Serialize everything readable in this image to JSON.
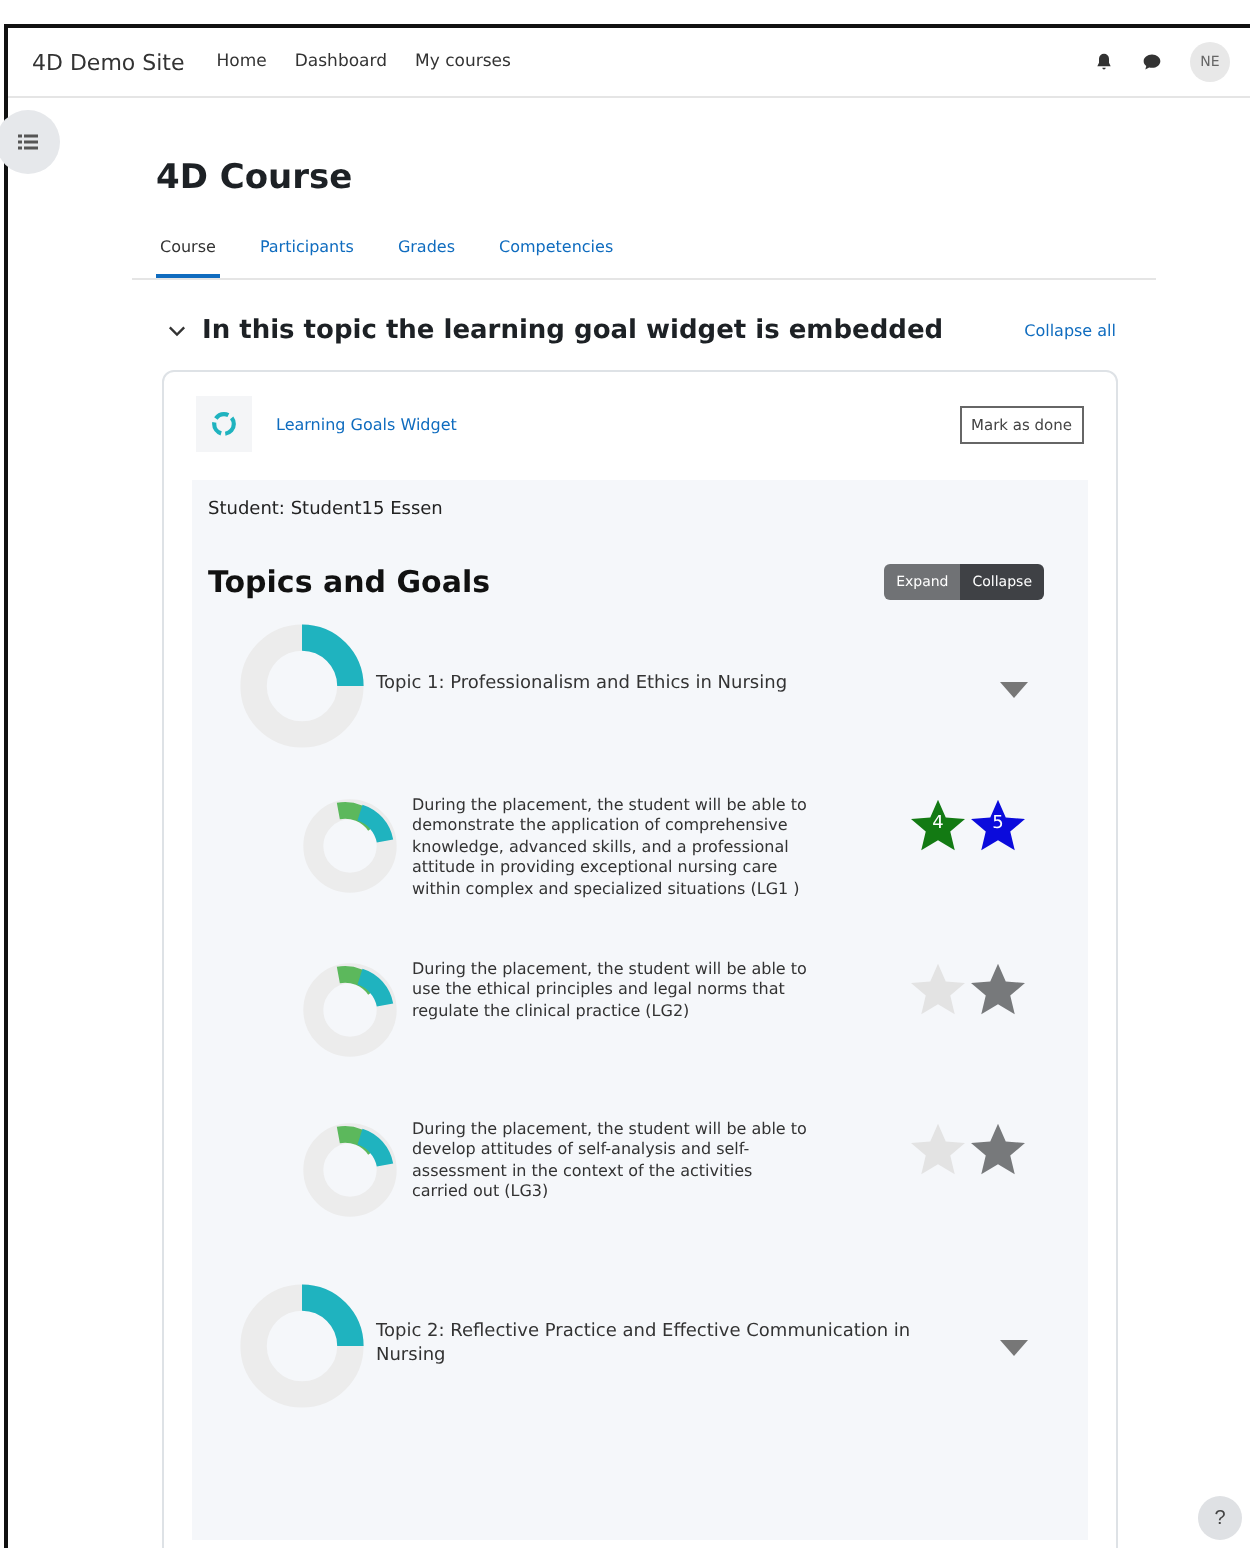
{
  "navbar": {
    "site_name": "4D Demo Site",
    "links": [
      "Home",
      "Dashboard",
      "My courses"
    ],
    "avatar": "NE"
  },
  "course": {
    "title": "4D Course",
    "tabs": [
      {
        "label": "Course",
        "selected": true
      },
      {
        "label": "Participants",
        "selected": false
      },
      {
        "label": "Grades",
        "selected": false
      },
      {
        "label": "Competencies",
        "selected": false
      }
    ]
  },
  "section": {
    "title": "In this topic the learning goal widget is embedded",
    "expanded": true,
    "collapse_all": "Collapse all"
  },
  "activity": {
    "name": "Learning Goals Widget",
    "mark_button": "Mark as done"
  },
  "widget": {
    "student": "Student: Student15 Essen",
    "heading": "Topics and Goals",
    "toggle": [
      {
        "label": "Expand",
        "selected": false
      },
      {
        "label": "Collapse",
        "selected": true
      }
    ],
    "items": [
      {
        "kind": "topic",
        "text": "Topic 1: Professionalism and Ethics in Nursing"
      },
      {
        "kind": "goal",
        "text": "During the placement, the student will be able to demonstrate the application of comprehensive knowledge, advanced skills, and a professional attitude in providing exceptional nursing care within complex and specialized situations (LG1 )",
        "stars": [
          {
            "label": "4",
            "color": "#137a13"
          },
          {
            "label": "5",
            "color": "#0b0bdc"
          }
        ]
      },
      {
        "kind": "goal",
        "text": "During the placement, the student will be able to use the ethical principles and legal norms that regulate the clinical practice (LG2)",
        "stars": [
          {
            "color": "#e3e3e3"
          },
          {
            "color": "#77797b"
          }
        ]
      },
      {
        "kind": "goal",
        "text": "During the placement, the student will be able to develop attitudes of self-analysis and self-assessment in the context of the activities carried out (LG3)",
        "stars": [
          {
            "color": "#e3e3e3"
          },
          {
            "color": "#77797b"
          }
        ]
      },
      {
        "kind": "topic",
        "text": "Topic 2: Reflective Practice and Effective Communication in Nursing"
      }
    ]
  },
  "help_button": "?"
}
